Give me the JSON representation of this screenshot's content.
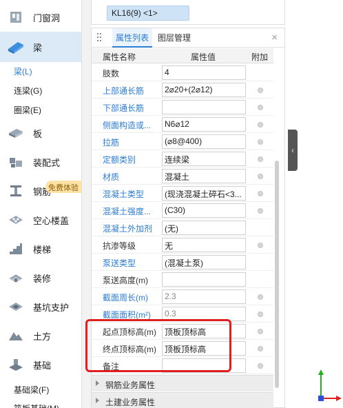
{
  "sidebar": {
    "categories": [
      {
        "label": "门窗洞",
        "icon": "door-window-icon"
      },
      {
        "label": "梁",
        "icon": "beam-icon"
      },
      {
        "label": "板",
        "icon": "slab-icon"
      },
      {
        "label": "装配式",
        "icon": "prefab-icon"
      },
      {
        "label": "钢筋",
        "icon": "steel-icon"
      },
      {
        "label": "空心楼盖",
        "icon": "hollow-floor-icon"
      },
      {
        "label": "楼梯",
        "icon": "stairs-icon"
      },
      {
        "label": "装修",
        "icon": "decoration-icon"
      },
      {
        "label": "基坑支护",
        "icon": "pit-support-icon"
      },
      {
        "label": "土方",
        "icon": "earthwork-icon"
      },
      {
        "label": "基础",
        "icon": "foundation-icon"
      }
    ],
    "beam_subitems": [
      "梁(L)",
      "连梁(G)",
      "圈梁(E)"
    ],
    "foundation_subitems": [
      "基础梁(F)",
      "筏板基础(M)"
    ],
    "promo_badge": "免费体验"
  },
  "selected_element": "KL16(9) <1>",
  "panel": {
    "tabs": [
      "属性列表",
      "图层管理"
    ],
    "close_icon": "×",
    "columns": {
      "name": "属性名称",
      "value": "属性值",
      "add": "附加"
    },
    "rows": [
      {
        "idx": "1",
        "name": "肢数",
        "value": "4",
        "blue": false,
        "check": false
      },
      {
        "idx": "2",
        "name": "上部通长筋",
        "value": "2⌀20+(2⌀12)",
        "blue": true,
        "check": true
      },
      {
        "idx": "3",
        "name": "下部通长筋",
        "value": "",
        "blue": true,
        "check": true
      },
      {
        "idx": "4",
        "name": "侧面构造或...",
        "value": "N6⌀12",
        "blue": true,
        "check": true
      },
      {
        "idx": "5",
        "name": "拉筋",
        "value": "(⌀8@400)",
        "blue": true,
        "check": true
      },
      {
        "idx": "6",
        "name": "定额类别",
        "value": "连续梁",
        "blue": true,
        "check": true
      },
      {
        "idx": "7",
        "name": "材质",
        "value": "混凝土",
        "blue": true,
        "check": true
      },
      {
        "idx": "8",
        "name": "混凝土类型",
        "value": "(现浇混凝土碎石<3...",
        "blue": true,
        "check": true
      },
      {
        "idx": "9",
        "name": "混凝土强度...",
        "value": "(C30)",
        "blue": true,
        "check": true
      },
      {
        "idx": "10",
        "name": "混凝土外加剂",
        "value": "(无)",
        "blue": true,
        "check": false
      },
      {
        "idx": "11",
        "name": "抗渗等级",
        "value": "无",
        "blue": false,
        "check": true
      },
      {
        "idx": "12",
        "name": "泵送类型",
        "value": "(混凝土泵)",
        "blue": true,
        "check": false
      },
      {
        "idx": "13",
        "name": "泵送高度(m)",
        "value": "",
        "blue": false,
        "check": false
      },
      {
        "idx": "14",
        "name": "截面周长(m)",
        "value": "2.3",
        "blue": true,
        "check": true,
        "gray": true
      },
      {
        "idx": "15",
        "name": "截面面积(m²)",
        "value": "0.3",
        "blue": true,
        "check": true,
        "gray": true
      },
      {
        "idx": "16",
        "name": "起点顶标高(m)",
        "value": "顶板顶标高",
        "blue": false,
        "check": true
      },
      {
        "idx": "17",
        "name": "终点顶标高(m)",
        "value": "顶板顶标高",
        "blue": false,
        "check": true
      },
      {
        "idx": "18",
        "name": "备注",
        "value": "",
        "blue": false,
        "check": true
      }
    ],
    "groups": [
      "钢筋业务属性",
      "土建业务属性"
    ]
  },
  "collapse_icon": "‹",
  "colors": {
    "accent": "#2b7cd3",
    "highlight": "#e02020",
    "selected_bg": "#dce9f7"
  }
}
